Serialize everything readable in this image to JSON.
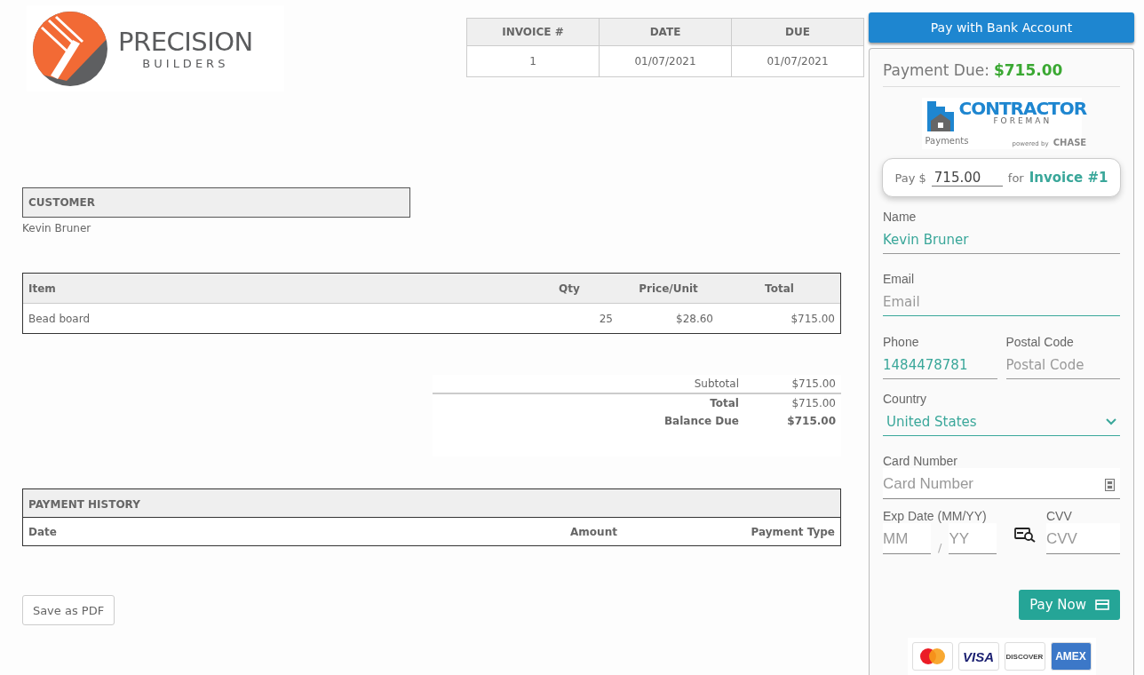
{
  "logo": {
    "name": "PRECISION",
    "tagline": "BUILDERS"
  },
  "invoice_meta": {
    "columns": [
      "INVOICE #",
      "DATE",
      "DUE"
    ],
    "values": [
      "1",
      "01/07/2021",
      "01/07/2021"
    ]
  },
  "customer": {
    "heading": "CUSTOMER",
    "name": "Kevin Bruner"
  },
  "items": {
    "columns": [
      "Item",
      "Qty",
      "Price/Unit",
      "Total"
    ],
    "rows": [
      [
        "Bead board",
        "25",
        "$28.60",
        "$715.00"
      ]
    ]
  },
  "totals": [
    {
      "kind": "subtotal",
      "label": "Subtotal",
      "value": "$715.00"
    },
    {
      "kind": "total",
      "label": "Total",
      "value": "$715.00"
    },
    {
      "kind": "balance",
      "label": "Balance Due",
      "value": "$715.00"
    }
  ],
  "payment_history": {
    "heading": "PAYMENT HISTORY",
    "columns": [
      "Date",
      "Amount",
      "Payment Type"
    ]
  },
  "save_button": "Save as PDF",
  "payment": {
    "bank_button": "Pay with Bank Account",
    "due_label": "Payment Due:",
    "due_amount": "$715.00",
    "brand": {
      "name": "CONTRACTOR",
      "sub": "FOREMAN",
      "payments": "Payments",
      "powered": "powered by",
      "bank": "CHASE"
    },
    "pay_prefix": "Pay $",
    "pay_amount": "715.00",
    "pay_for": "for",
    "invoice_link": "Invoice #1",
    "fields": [
      {
        "kind": "text",
        "label": "Name",
        "value": "Kevin Bruner"
      },
      {
        "kind": "text",
        "label": "Email",
        "placeholder": "Email"
      },
      {
        "kind": "pair",
        "items": [
          {
            "label": "Phone",
            "value": "1484478781"
          },
          {
            "label": "Postal Code",
            "placeholder": "Postal Code"
          }
        ]
      },
      {
        "kind": "select",
        "label": "Country",
        "value": "United States"
      }
    ],
    "card_label": "Card Number",
    "card_placeholder": "Card Number",
    "exp_label": "Exp Date (MM/YY)",
    "mm_placeholder": "MM",
    "slash": "/",
    "yy_placeholder": "YY",
    "cvv_label": "CVV",
    "cvv_placeholder": "CVV",
    "pay_button": "Pay Now",
    "card_brands": [
      {
        "kind": "mastercard"
      },
      {
        "kind": "visa",
        "label": "VISA"
      },
      {
        "kind": "discover",
        "label": "DISCOVER"
      },
      {
        "kind": "amex",
        "label": "AMEX"
      }
    ]
  }
}
